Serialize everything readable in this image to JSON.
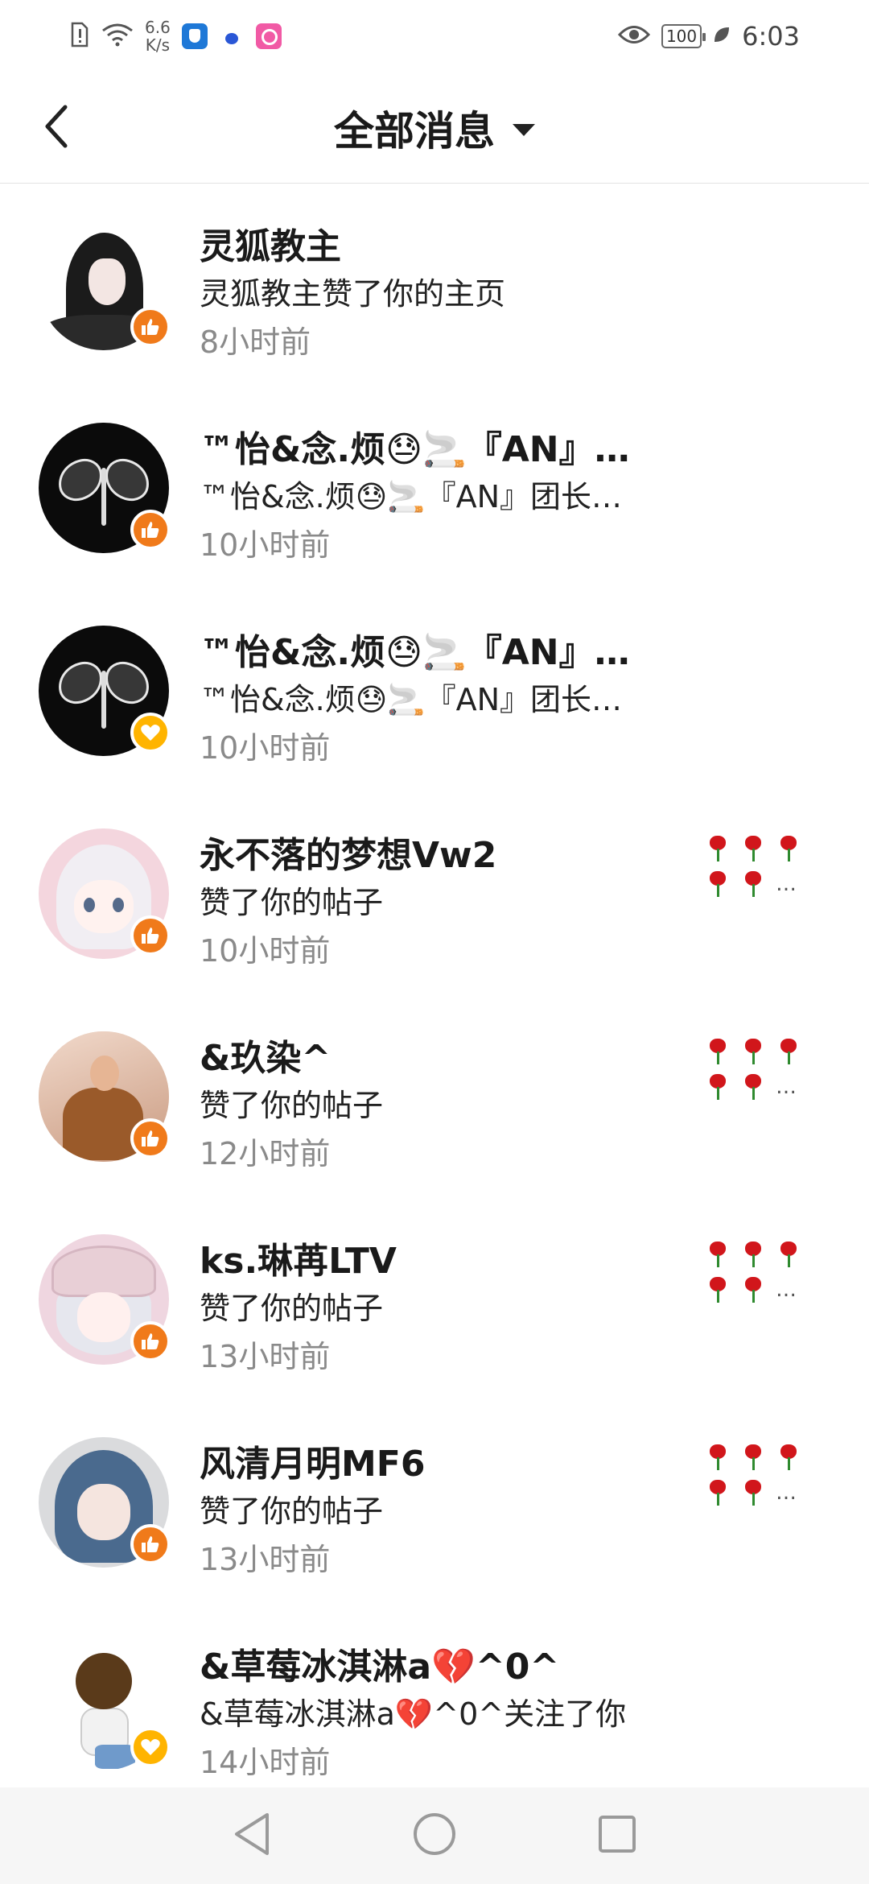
{
  "status_bar": {
    "net_speed_value": "6.6",
    "net_speed_unit": "K/s",
    "battery": "100",
    "time": "6:03"
  },
  "header": {
    "title": "全部消息"
  },
  "colors": {
    "like_badge": "#f07a1a",
    "heart_badge": "#ffb400",
    "time_text": "#8a8a8a"
  },
  "messages": [
    {
      "name": "灵狐教主",
      "desc": "灵狐教主赞了你的主页",
      "time": "8小时前",
      "badge": "like-icon"
    },
    {
      "name": "™怡&念.烦😓🚬『AN』…",
      "desc": "™怡&念.烦😓🚬『AN』团长…",
      "time": "10小时前",
      "badge": "like-icon"
    },
    {
      "name": "™怡&念.烦😓🚬『AN』…",
      "desc": "™怡&念.烦😓🚬『AN』团长…",
      "time": "10小时前",
      "badge": "heart-icon"
    },
    {
      "name": "永不落的梦想Vw2",
      "desc": "赞了你的帖子",
      "time": "10小时前",
      "badge": "like-icon",
      "thumb_more": "…"
    },
    {
      "name": "&玖染^",
      "desc": "赞了你的帖子",
      "time": "12小时前",
      "badge": "like-icon",
      "thumb_more": "…"
    },
    {
      "name": "ks.琳苒LTV",
      "desc": "赞了你的帖子",
      "time": "13小时前",
      "badge": "like-icon",
      "thumb_more": "…"
    },
    {
      "name": "风清月明MF6",
      "desc": "赞了你的帖子",
      "time": "13小时前",
      "badge": "like-icon",
      "thumb_more": "…"
    },
    {
      "name": "&草莓冰淇淋a💔^0^",
      "desc": "&草莓冰淇淋a💔^0^关注了你",
      "time": "14小时前",
      "badge": "heart-icon"
    }
  ]
}
